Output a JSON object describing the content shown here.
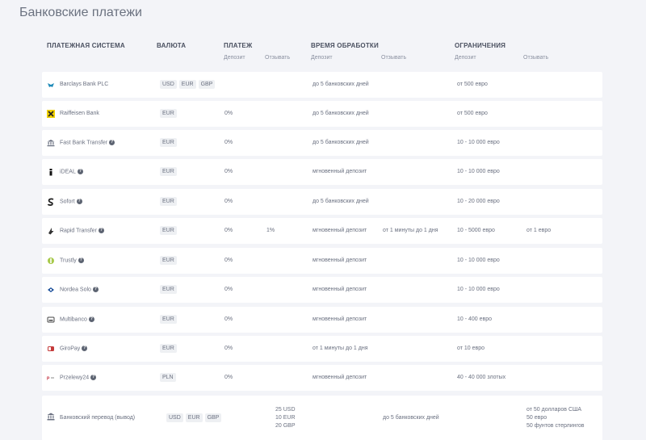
{
  "page_title": "Банковские платежи",
  "headers": {
    "system": "ПЛАТЕЖНАЯ СИСТЕМА",
    "currency": "ВАЛЮТА",
    "fee": "ПЛАТЕЖ",
    "time": "ВРЕМЯ ОБРАБОТКИ",
    "limits": "ОГРАНИЧЕНИЯ",
    "deposit": "Депозит",
    "withdraw": "Отзывать"
  },
  "rows": [
    {
      "name": "Barclays Bank PLC",
      "help": false,
      "currencies": [
        "USD",
        "EUR",
        "GBP"
      ],
      "fee_dep": "",
      "fee_wd": "",
      "time_dep": "до 5 банковских дней",
      "time_wd": "",
      "lim_dep": "от 500 евро",
      "lim_wd": "",
      "icon": "barclays-eagle-icon"
    },
    {
      "name": "Raiffeisen Bank",
      "help": false,
      "currencies": [
        "EUR"
      ],
      "fee_dep": "0%",
      "fee_wd": "",
      "time_dep": "до 5 банковских дней",
      "time_wd": "",
      "lim_dep": "от 500 евро",
      "lim_wd": "",
      "icon": "raiffeisen-icon"
    },
    {
      "name": "Fast Bank Transfer",
      "help": true,
      "currencies": [
        "EUR"
      ],
      "fee_dep": "0%",
      "fee_wd": "",
      "time_dep": "до 5 банковских дней",
      "time_wd": "",
      "lim_dep": "10 - 10 000 евро",
      "lim_wd": "",
      "icon": "bank-transfer-icon"
    },
    {
      "name": "iDEAL",
      "help": true,
      "currencies": [
        "EUR"
      ],
      "fee_dep": "0%",
      "fee_wd": "",
      "time_dep": "мгновенный депозит",
      "time_wd": "",
      "lim_dep": "10 - 10 000 евро",
      "lim_wd": "",
      "icon": "ideal-icon"
    },
    {
      "name": "Sofort",
      "help": true,
      "currencies": [
        "EUR"
      ],
      "fee_dep": "0%",
      "fee_wd": "",
      "time_dep": "до 5 банковских дней",
      "time_wd": "",
      "lim_dep": "10 - 20 000 евро",
      "lim_wd": "",
      "icon": "sofort-icon"
    },
    {
      "name": "Rapid Transfer",
      "help": true,
      "currencies": [
        "EUR"
      ],
      "fee_dep": "0%",
      "fee_wd": "1%",
      "time_dep": "мгновенный депозит",
      "time_wd": "от 1 минуты до 1 дня",
      "lim_dep": "10 - 5000 евро",
      "lim_wd": "от 1 евро",
      "icon": "rapid-transfer-icon"
    },
    {
      "name": "Trustly",
      "help": true,
      "currencies": [
        "EUR"
      ],
      "fee_dep": "0%",
      "fee_wd": "",
      "time_dep": "мгновенный депозит",
      "time_wd": "",
      "lim_dep": "10 - 10 000 евро",
      "lim_wd": "",
      "icon": "trustly-icon"
    },
    {
      "name": "Nordea Solo",
      "help": true,
      "currencies": [
        "EUR"
      ],
      "fee_dep": "0%",
      "fee_wd": "",
      "time_dep": "мгновенный депозит",
      "time_wd": "",
      "lim_dep": "10 - 10 000 евро",
      "lim_wd": "",
      "icon": "nordea-icon"
    },
    {
      "name": "Multibanco",
      "help": true,
      "currencies": [
        "EUR"
      ],
      "fee_dep": "0%",
      "fee_wd": "",
      "time_dep": "мгновенный депозит",
      "time_wd": "",
      "lim_dep": "10 - 400 евро",
      "lim_wd": "",
      "icon": "multibanco-icon"
    },
    {
      "name": "GiroPay",
      "help": true,
      "currencies": [
        "EUR"
      ],
      "fee_dep": "0%",
      "fee_wd": "",
      "time_dep": "от 1 минуты до 1 дня",
      "time_wd": "",
      "lim_dep": "от 10 евро",
      "lim_wd": "",
      "icon": "giropay-icon"
    },
    {
      "name": "Przelewy24",
      "help": true,
      "currencies": [
        "PLN"
      ],
      "fee_dep": "0%",
      "fee_wd": "",
      "time_dep": "мгновенный депозит",
      "time_wd": "",
      "lim_dep": "40 - 40 000 злотых",
      "lim_wd": "",
      "icon": "przelewy24-icon"
    }
  ],
  "last_row": {
    "name": "Банковский перевод (вывод)",
    "currencies": [
      "USD",
      "EUR",
      "GBP"
    ],
    "fee_wd_lines": [
      "25 USD",
      "10 EUR",
      "20 GBP"
    ],
    "time_wd": "до 5 банковских дней",
    "lim_wd_lines": [
      "от 50 долларов США",
      "50 евро",
      "50 фунтов стерлингов"
    ],
    "icon": "bank-building-icon"
  }
}
